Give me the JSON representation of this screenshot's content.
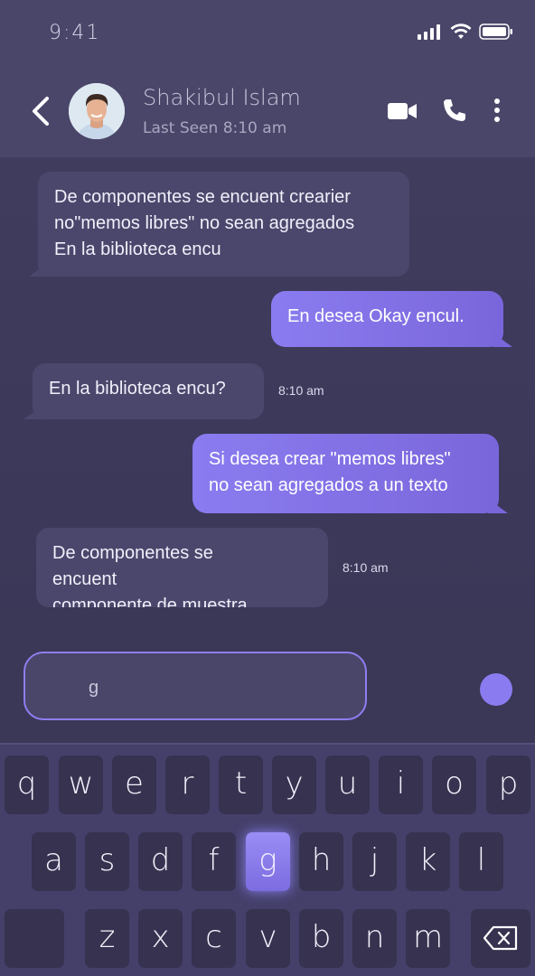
{
  "status_bar": {
    "time": "9:41"
  },
  "header": {
    "contact_name": "Shakibul Islam",
    "last_seen": "Last Seen 8:10 am",
    "icons": [
      "back-chevron-icon",
      "video-call-icon",
      "phone-icon",
      "more-vertical-icon"
    ]
  },
  "messages": [
    {
      "direction": "in",
      "text": "De componentes se encuent crearier\nno\"memos libres\" no sean agregados\nEn la biblioteca encu"
    },
    {
      "direction": "out",
      "text": "En desea Okay encul."
    },
    {
      "direction": "in",
      "text": "En la biblioteca encu?",
      "time": "8:10 am"
    },
    {
      "direction": "out",
      "text": "Si desea crear \"memos libres\"\nno sean agregados a un texto"
    },
    {
      "direction": "in",
      "text": "De componentes se\nencuent\ncomponente de muestra",
      "time": "8:10 am"
    }
  ],
  "composer": {
    "input_value": "g"
  },
  "keyboard": {
    "row1": [
      "q",
      "w",
      "e",
      "r",
      "t",
      "y",
      "u",
      "i",
      "o",
      "p"
    ],
    "row2": [
      "a",
      "s",
      "d",
      "f",
      "g",
      "h",
      "j",
      "k",
      "l"
    ],
    "row3": [
      "z",
      "x",
      "c",
      "v",
      "b",
      "n",
      "m"
    ],
    "active_key": "g"
  },
  "colors": {
    "accent": "#8a7cf0",
    "background": "#403c5e",
    "incoming_bubble": "#4b476c"
  }
}
